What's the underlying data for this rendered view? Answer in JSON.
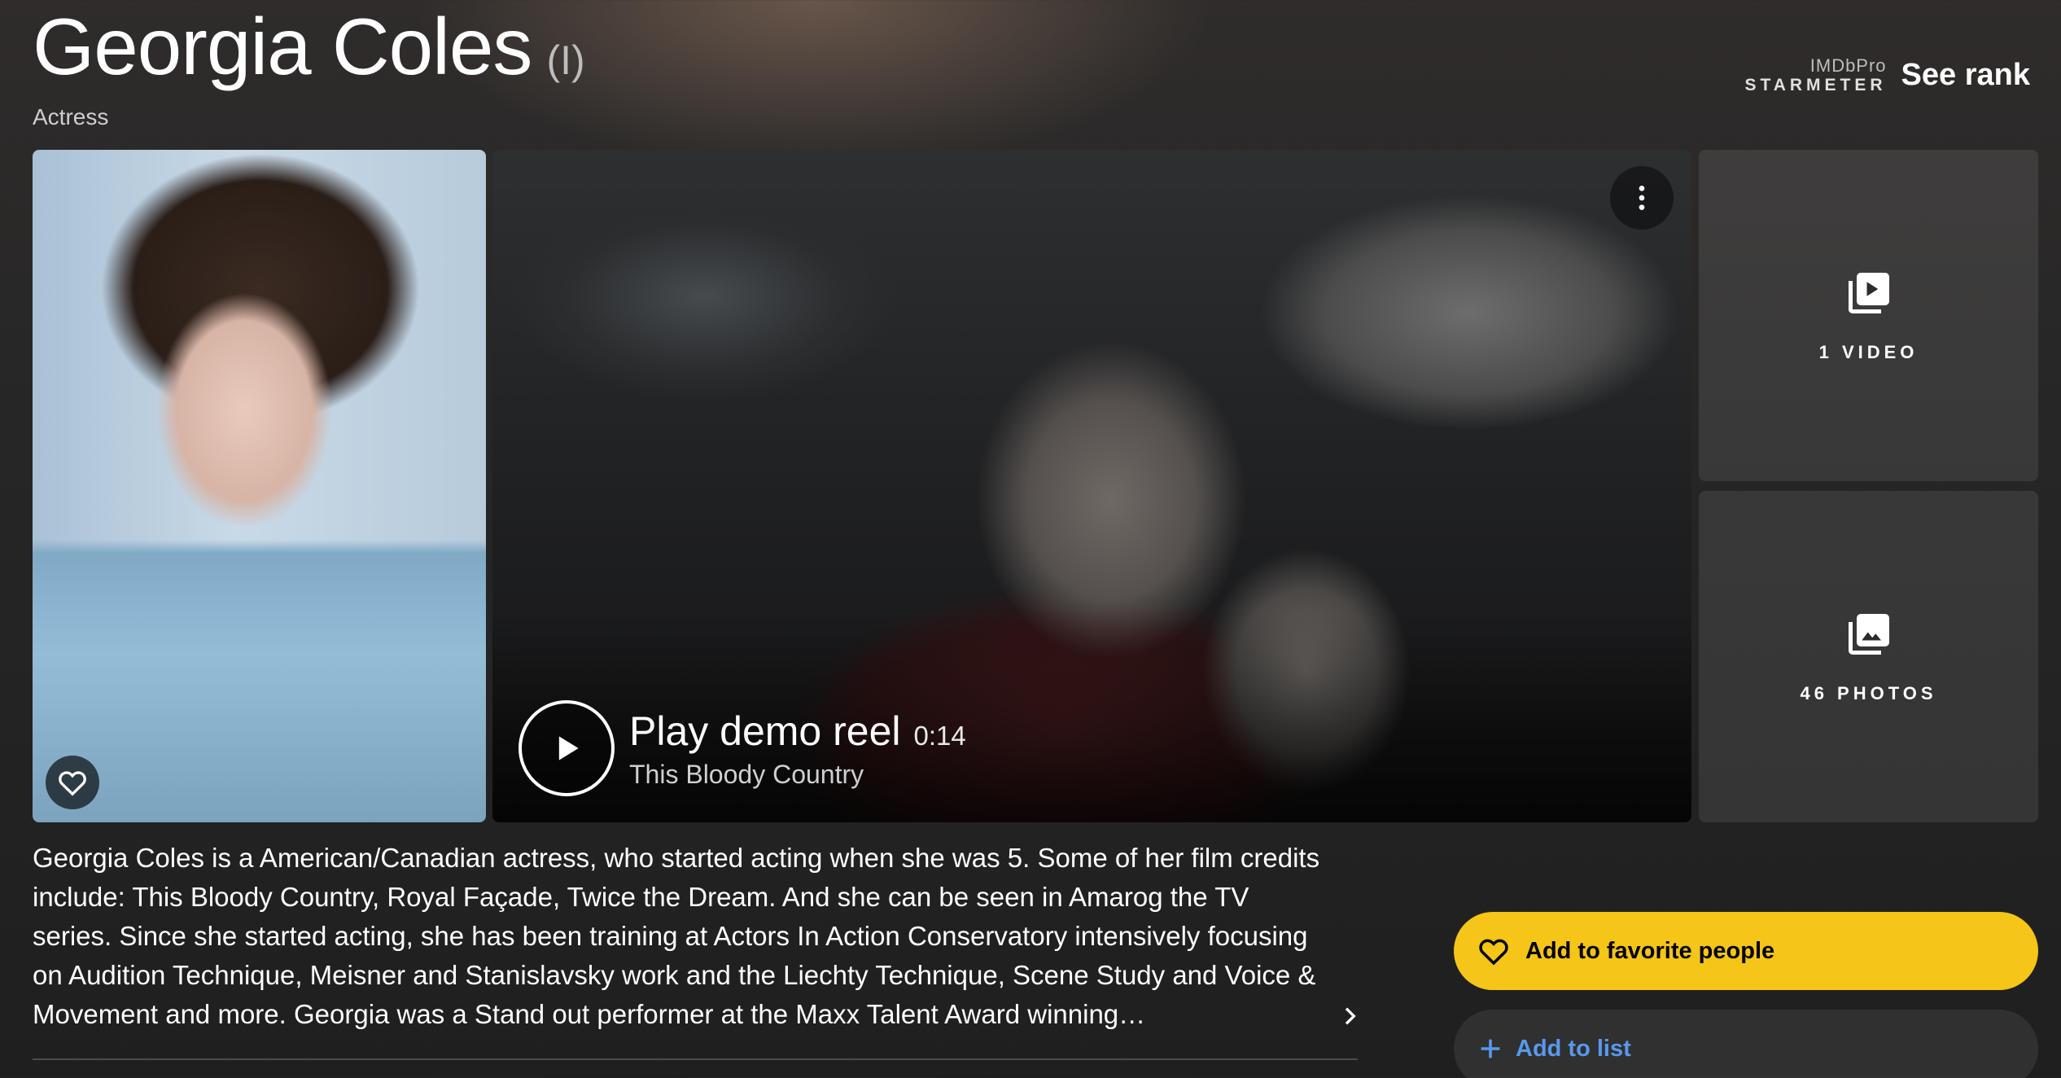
{
  "hero": {
    "name": "Georgia Coles",
    "qualifier": "(I)",
    "role": "Actress"
  },
  "starmeter": {
    "pro_label": "IMDbPro",
    "label": "STARMETER",
    "rank_link": "See rank"
  },
  "video": {
    "play_label": "Play demo reel",
    "duration": "0:14",
    "title": "This Bloody Country"
  },
  "tiles": {
    "videos_label": "1 VIDEO",
    "photos_label": "46 PHOTOS"
  },
  "bio": {
    "text": "Georgia Coles is a American/Canadian actress, who started acting when she was 5. Some of her film credits include: This Bloody Country, Royal Façade, Twice the Dream. And she can be seen in Amarog the TV series. Since she started acting, she has been training at Actors In Action Conservatory intensively focusing on Audition Technique, Meisner and Stanislavsky work and the Liechty Technique, Scene Study and Voice & Movement and more. Georgia was a Stand out performer at the Maxx Talent Award winning…"
  },
  "actions": {
    "favorite_label": "Add to favorite people",
    "list_label": "Add to list"
  },
  "colors": {
    "accent": "#f5c518",
    "link": "#5799ef"
  }
}
